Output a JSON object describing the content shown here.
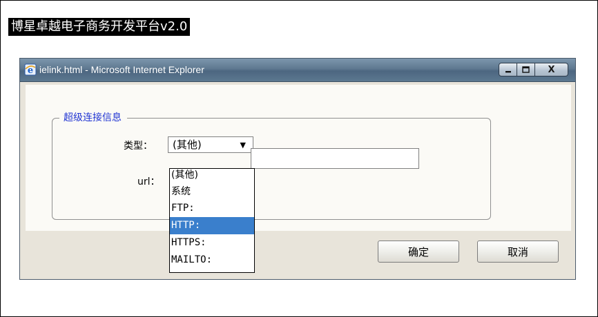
{
  "app": {
    "title": "博星卓越电子商务开发平台v2.0"
  },
  "window": {
    "title": "ielink.html - Microsoft Internet Explorer",
    "controls": {
      "minimize": "_",
      "maximize": "□",
      "close": "X"
    }
  },
  "form": {
    "legend": "超级连接信息",
    "type_label": "类型：",
    "type_value": "(其他)",
    "url_label": "url：",
    "url_value": ""
  },
  "dropdown": {
    "options": [
      "(其他)",
      "系统",
      "FTP:",
      "HTTP:",
      "HTTPS:",
      "MAILTO:"
    ],
    "selected": "HTTP:"
  },
  "buttons": {
    "ok": "确定",
    "cancel": "取消"
  },
  "icons": {
    "window": "ie-logo-icon",
    "select_arrow": "chevron-down-icon"
  },
  "colors": {
    "titlebar": "#5e7890",
    "legend": "#2135d3",
    "selection": "#3a7fcc"
  }
}
